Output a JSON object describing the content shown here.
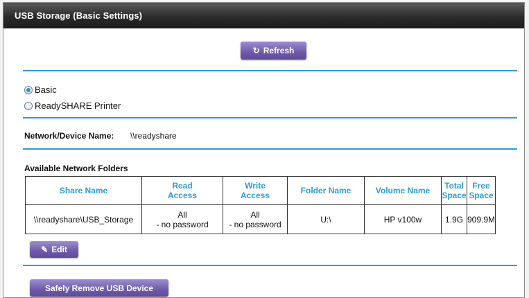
{
  "window": {
    "title": "USB Storage (Basic Settings)"
  },
  "toolbar": {
    "refresh_label": "Refresh",
    "refresh_icon": "refresh-icon"
  },
  "mode": {
    "options": [
      {
        "label": "Basic",
        "checked": true
      },
      {
        "label": "ReadySHARE Printer",
        "checked": false
      }
    ]
  },
  "network": {
    "label": "Network/Device Name:",
    "value": "\\\\readyshare"
  },
  "folders": {
    "heading": "Available Network Folders",
    "columns": {
      "share_name": "Share Name",
      "read_access_1": "Read",
      "read_access_2": "Access",
      "write_access_1": "Write",
      "write_access_2": "Access",
      "folder_name": "Folder Name",
      "volume_name": "Volume Name",
      "total_space_1": "Total",
      "total_space_2": "Space",
      "free_space_1": "Free",
      "free_space_2": "Space"
    },
    "rows": [
      {
        "share_name": "\\\\readyshare\\USB_Storage",
        "read_access_1": "All",
        "read_access_2": "- no password",
        "write_access_1": "All",
        "write_access_2": "- no password",
        "folder_name": "U:\\",
        "volume_name": "HP v100w",
        "total_space": "1.9G",
        "free_space": "909.9M"
      }
    ],
    "edit_label": "Edit",
    "edit_icon": "pencil-icon"
  },
  "actions": {
    "remove_label": "Safely Remove USB Device"
  },
  "colors": {
    "accent": "#2f9bd4",
    "button": "#6e5aa8",
    "titlebar": "#2b2b2b"
  }
}
